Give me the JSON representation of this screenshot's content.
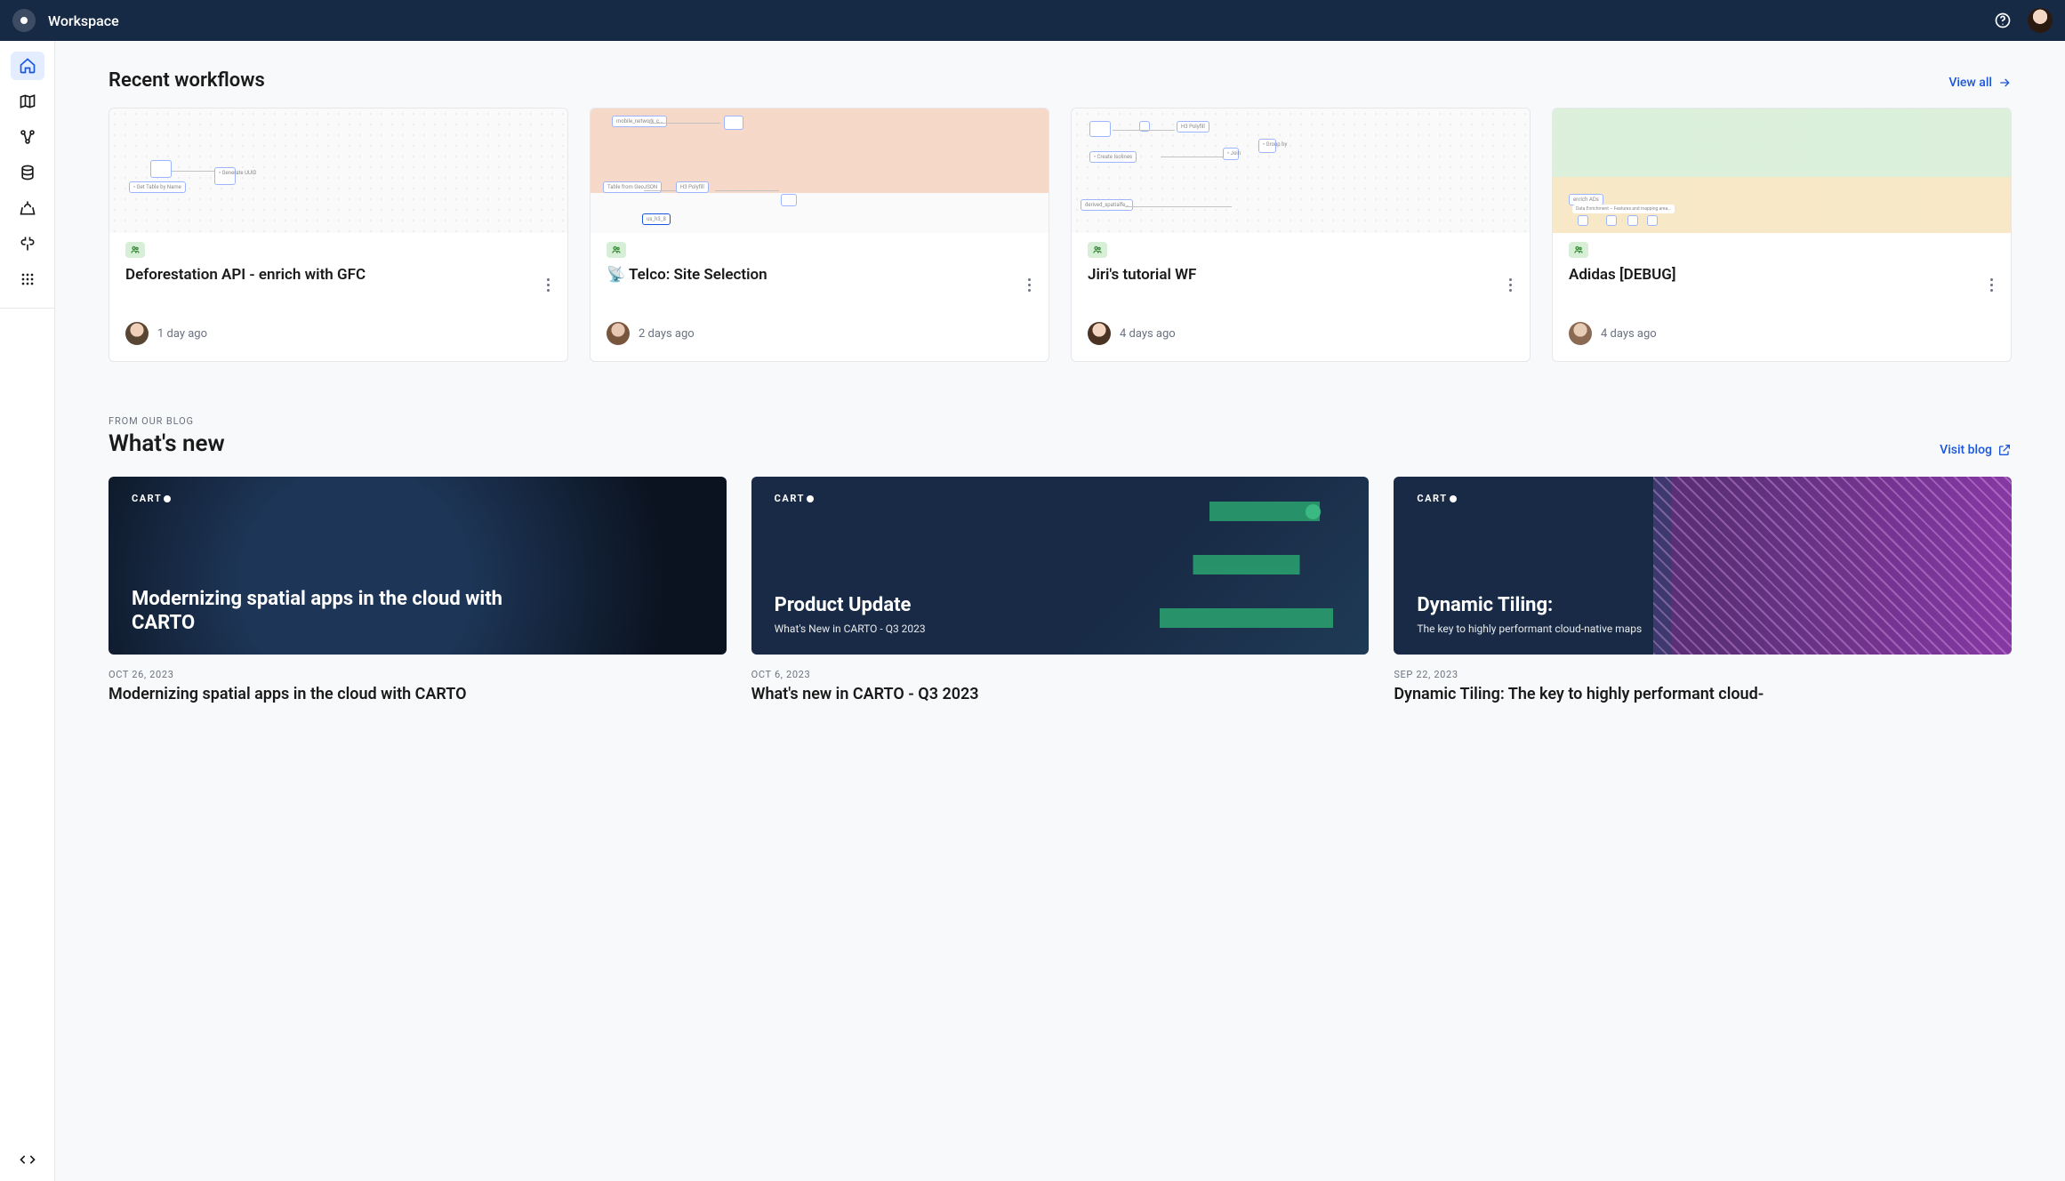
{
  "header": {
    "title": "Workspace"
  },
  "sidebar": {
    "items": [
      {
        "name": "home",
        "active": true
      },
      {
        "name": "maps"
      },
      {
        "name": "workflows"
      },
      {
        "name": "data"
      },
      {
        "name": "explore"
      },
      {
        "name": "connections"
      },
      {
        "name": "apps"
      }
    ],
    "bottom_item": {
      "name": "developers"
    }
  },
  "recent_workflows": {
    "heading": "Recent workflows",
    "view_all_label": "View all",
    "cards": [
      {
        "title": "Deforestation API - enrich with GFC",
        "time": "1 day ago",
        "thumb_variant": "plain"
      },
      {
        "title": "📡 Telco: Site Selection",
        "time": "2 days ago",
        "thumb_variant": "peach"
      },
      {
        "title": "Jiri's tutorial WF",
        "time": "4 days ago",
        "thumb_variant": "plain"
      },
      {
        "title": "Adidas [DEBUG]",
        "time": "4 days ago",
        "thumb_variant": "green"
      }
    ]
  },
  "blog": {
    "eyebrow": "FROM OUR BLOG",
    "heading": "What's new",
    "visit_label": "Visit blog",
    "brand_text": "CART",
    "posts": [
      {
        "cover_title": "Modernizing spatial apps in the cloud with CARTO",
        "cover_sub": "",
        "date": "OCT 26, 2023",
        "title": "Modernizing spatial apps in the cloud with CARTO",
        "variant": "v0"
      },
      {
        "cover_title": "Product Update",
        "cover_sub": "What's New in CARTO - Q3 2023",
        "date": "OCT 6, 2023",
        "title": "What's new in CARTO - Q3 2023",
        "variant": "v1"
      },
      {
        "cover_title": "Dynamic Tiling:",
        "cover_sub": "The key to highly performant cloud-native maps",
        "date": "SEP 22, 2023",
        "title": "Dynamic Tiling: The key to highly performant cloud-",
        "variant": "v2"
      }
    ]
  }
}
